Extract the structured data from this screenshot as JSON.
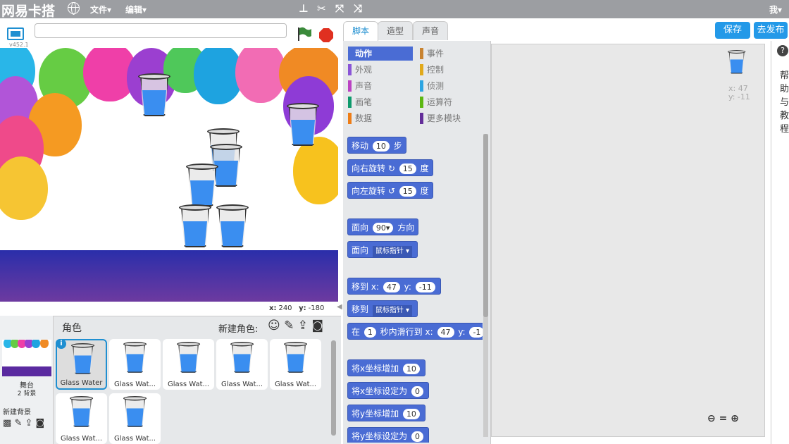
{
  "topbar": {
    "logo": "网易卡搭",
    "menu_file": "文件▾",
    "menu_edit": "编辑▾",
    "user": "我▾"
  },
  "stage": {
    "version": "v452.1",
    "project_title": "",
    "coords_x_label": "x:",
    "coords_x": "240",
    "coords_y_label": "y:",
    "coords_y": "-180"
  },
  "sprites_panel": {
    "header": "角色",
    "new_sprite_label": "新建角色:",
    "stage_label": "舞台",
    "backdrop_count": "2 背景",
    "new_backdrop_label": "新建背景",
    "sprites": [
      {
        "name": "Glass Water"
      },
      {
        "name": "Glass Wat..."
      },
      {
        "name": "Glass Wat..."
      },
      {
        "name": "Glass Wat..."
      },
      {
        "name": "Glass Wat..."
      },
      {
        "name": "Glass Wat..."
      },
      {
        "name": "Glass Wat..."
      }
    ]
  },
  "tabs": {
    "scripts": "脚本",
    "costumes": "造型",
    "sounds": "声音"
  },
  "buttons": {
    "save": "保存",
    "share": "去发布"
  },
  "categories": [
    {
      "label": "动作",
      "color": "#4a6cd4"
    },
    {
      "label": "事件",
      "color": "#c88330"
    },
    {
      "label": "外观",
      "color": "#8a55d7"
    },
    {
      "label": "控制",
      "color": "#e1a91a"
    },
    {
      "label": "声音",
      "color": "#bb42c3"
    },
    {
      "label": "侦测",
      "color": "#2ca5e2"
    },
    {
      "label": "画笔",
      "color": "#0e9a6c"
    },
    {
      "label": "运算符",
      "color": "#5cb712"
    },
    {
      "label": "数据",
      "color": "#ee7d16"
    },
    {
      "label": "更多模块",
      "color": "#632d99"
    }
  ],
  "blocks": {
    "move": {
      "label": "移动",
      "value": "10",
      "unit": "步"
    },
    "turn_right": {
      "label": "向右旋转",
      "value": "15",
      "unit": "度"
    },
    "turn_left": {
      "label": "向左旋转",
      "value": "15",
      "unit": "度"
    },
    "point_dir": {
      "label": "面向",
      "value": "90▾",
      "unit": "方向"
    },
    "point_towards": {
      "label": "面向",
      "value": "鼠标指针"
    },
    "goto_xy": {
      "label": "移到",
      "x_label": "x:",
      "x": "47",
      "y_label": "y:",
      "y": "-11"
    },
    "goto": {
      "label": "移到",
      "value": "鼠标指针"
    },
    "glide": {
      "label": "在",
      "secs": "1",
      "mid": "秒内滑行到",
      "x_label": "x:",
      "x": "47",
      "y_label": "y:",
      "y": "-1"
    },
    "change_x": {
      "label": "将x坐标增加",
      "value": "10"
    },
    "set_x": {
      "label": "将x坐标设定为",
      "value": "0"
    },
    "change_y": {
      "label": "将y坐标增加",
      "value": "10"
    },
    "set_y": {
      "label": "将y坐标设定为",
      "value": "0"
    }
  },
  "script_area": {
    "x_label": "x:",
    "x": "47",
    "y_label": "y:",
    "y": "-11"
  },
  "help": {
    "icon": "?",
    "text": "帮助与教程"
  }
}
